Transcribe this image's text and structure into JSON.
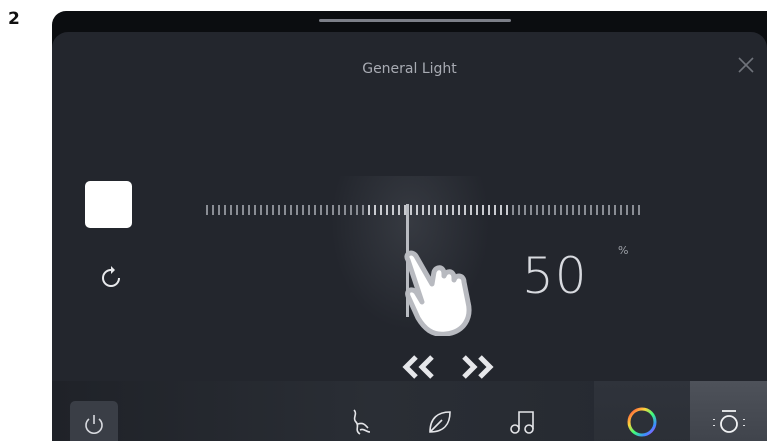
{
  "step": "2",
  "panel": {
    "title": "General Light"
  },
  "brightness": {
    "value": "50",
    "unit": "%",
    "level": 0.5
  },
  "tabs": [
    {
      "name": "scent-tab",
      "icon": "scent-icon",
      "active": false
    },
    {
      "name": "eco-tab",
      "icon": "leaf-icon",
      "active": false
    },
    {
      "name": "music-tab",
      "icon": "music-note-icon",
      "active": false
    },
    {
      "name": "color-tab",
      "icon": "color-ring-icon",
      "active": false
    },
    {
      "name": "light-tab",
      "icon": "lamp-icon",
      "active": true
    }
  ],
  "colors": {
    "panel_bg": "#23262d",
    "swatch": "#ffffff",
    "text_muted": "#a8abb3"
  }
}
